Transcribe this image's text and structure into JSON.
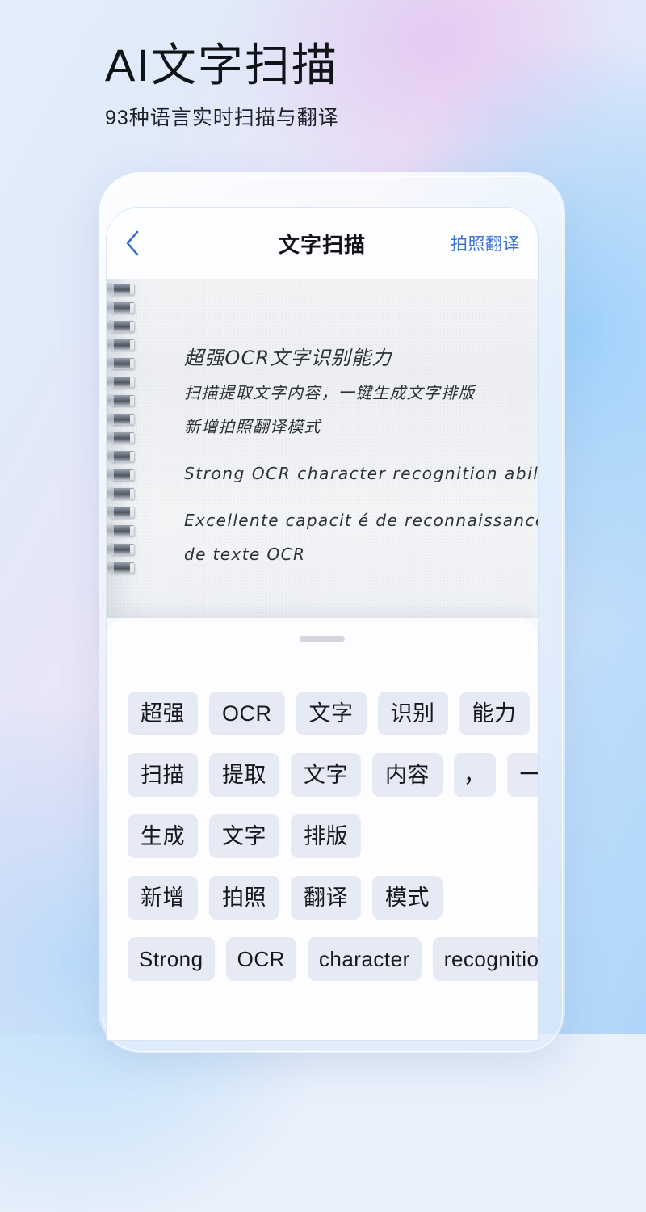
{
  "background": {
    "accent_blue": "#3b71d8",
    "gradient_from": "#e3eefb",
    "gradient_purple": "#e2c4f0",
    "gradient_to": "#aed6fa"
  },
  "hero": {
    "title": "AI文字扫描",
    "subtitle": "93种语言实时扫描与翻译"
  },
  "phone": {
    "navbar": {
      "back_icon": "chevron-left-icon",
      "title": "文字扫描",
      "action_label": "拍照翻译"
    },
    "paper": {
      "lines": [
        "超强OCR文字识别能力",
        "扫描提取文字内容，一键生成文字排版",
        "新增拍照翻译模式",
        "Strong OCR character recognition ability",
        "Excellente capacit é  de reconnaissance",
        "de texte OCR"
      ],
      "spiral_ring_count": 16
    },
    "sheet": {
      "handle": "drag-handle",
      "chip_rows": [
        [
          "超强",
          "OCR",
          "文字",
          "识别",
          "能力"
        ],
        [
          "扫描",
          "提取",
          "文字",
          "内容",
          "，",
          "一键"
        ],
        [
          "生成",
          "文字",
          "排版"
        ],
        [
          "新增",
          "拍照",
          "翻译",
          "模式"
        ],
        [
          "Strong",
          "OCR",
          "character",
          "recognition"
        ]
      ]
    }
  }
}
